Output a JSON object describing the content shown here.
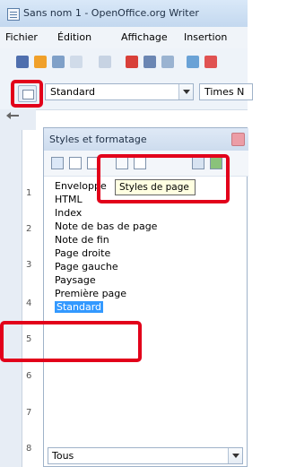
{
  "window": {
    "title": "Sans nom 1 - OpenOffice.org Writer"
  },
  "menubar": {
    "items": [
      "Fichier",
      "Édition",
      "Affichage",
      "Insertion"
    ]
  },
  "toolbar": {
    "paragraph_style_value": "Standard",
    "font_name_value": "Times N"
  },
  "ruler": {
    "numbers": [
      "1",
      "2",
      "3",
      "4",
      "5",
      "6",
      "7",
      "8"
    ]
  },
  "styles_panel": {
    "title": "Styles et formatage",
    "tooltip": "Styles de page",
    "items": [
      "Enveloppe",
      "HTML",
      "Index",
      "Note de bas de page",
      "Note de fin",
      "Page droite",
      "Page gauche",
      "Paysage",
      "Première page",
      "Standard"
    ],
    "selected": "Standard",
    "filter_value": "Tous"
  },
  "colors": {
    "highlight_red": "#e2001a",
    "selection_blue": "#3399ff"
  },
  "icons": {
    "app": "writer-document-icon",
    "stylist": "stylist-icon",
    "page_styles": "page-styles-icon",
    "paragraph_styles": "paragraph-styles-icon",
    "character_styles": "character-styles-icon",
    "frame_styles": "frame-styles-icon",
    "list_styles": "list-styles-icon",
    "fill_format": "fill-format-icon",
    "new_style": "new-style-from-selection-icon",
    "close": "close-icon"
  }
}
